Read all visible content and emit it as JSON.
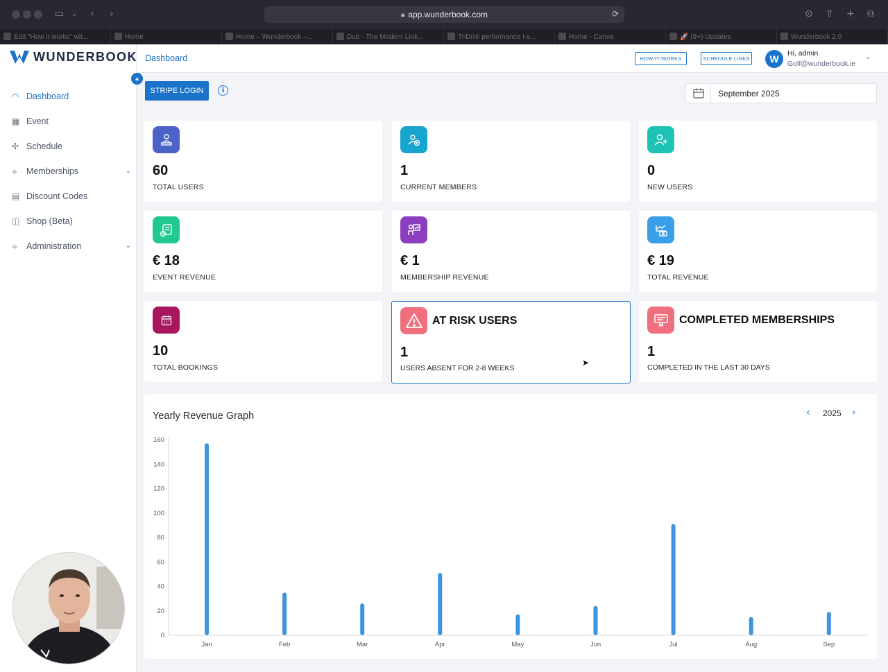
{
  "browser": {
    "url": "app.wunderbook.com",
    "tabs": [
      "Edit \"How it works\" wit...",
      "Home",
      "Home – Wunderbook –...",
      "Dub - The Modern Link...",
      "TriDri® performance t-s...",
      "Home - Canva",
      "🚀 (9+) Updates",
      "Wunderbook 2.0"
    ]
  },
  "brand": {
    "name": "WUNDERBOOK",
    "color": "#1a73c9"
  },
  "sidebar": {
    "items": [
      {
        "label": "Dashboard",
        "icon": "gauge-icon"
      },
      {
        "label": "Event",
        "icon": "calendar-icon"
      },
      {
        "label": "Schedule",
        "icon": "schedule-icon"
      },
      {
        "label": "Memberships",
        "icon": "membership-icon"
      },
      {
        "label": "Discount Codes",
        "icon": "ticket-icon"
      },
      {
        "label": "Shop (Beta)",
        "icon": "bag-icon"
      },
      {
        "label": "Administration",
        "icon": "admin-icon"
      }
    ]
  },
  "topbar": {
    "breadcrumb": "Dashboard",
    "how_it_works": "HOW-IT-WORKS",
    "schedule_links": "SCHEDULE LINKS",
    "greeting": "Hi, admin",
    "email": "Golf@wunderbook.ie",
    "avatar_letter": "W"
  },
  "controls": {
    "stripe_login": "STRIPE LOGIN",
    "date_value": "September 2025"
  },
  "stats": {
    "total_users": {
      "value": "60",
      "label": "TOTAL USERS"
    },
    "current_members": {
      "value": "1",
      "label": "CURRENT MEMBERS"
    },
    "new_users": {
      "value": "0",
      "label": "NEW USERS"
    },
    "event_revenue": {
      "value": "€ 18",
      "label": "EVENT REVENUE"
    },
    "membership_revenue": {
      "value": "€ 1",
      "label": "MEMBERSHIP REVENUE"
    },
    "total_revenue": {
      "value": "€ 19",
      "label": "TOTAL REVENUE"
    },
    "total_bookings": {
      "value": "10",
      "label": "TOTAL BOOKINGS"
    },
    "at_risk": {
      "title": "AT RISK USERS",
      "value": "1",
      "label": "USERS ABSENT FOR 2-8 WEEKS"
    },
    "completed": {
      "title": "COMPLETED MEMBERSHIPS",
      "value": "1",
      "label": "COMPLETED IN THE LAST 30 DAYS"
    }
  },
  "chart_section": {
    "title": "Yearly Revenue Graph",
    "year": "2025"
  },
  "chart_data": {
    "type": "bar",
    "title": "Yearly Revenue Graph",
    "categories": [
      "Jan",
      "Feb",
      "Mar",
      "Apr",
      "May",
      "Jun",
      "Jul",
      "Aug",
      "Sep"
    ],
    "values": [
      157,
      35,
      26,
      51,
      17,
      24,
      91,
      15,
      19
    ],
    "ylim": [
      0,
      160
    ],
    "yticks": [
      0,
      20,
      40,
      60,
      80,
      100,
      120,
      140,
      160
    ],
    "color": "#3d95e0",
    "grid": false
  }
}
